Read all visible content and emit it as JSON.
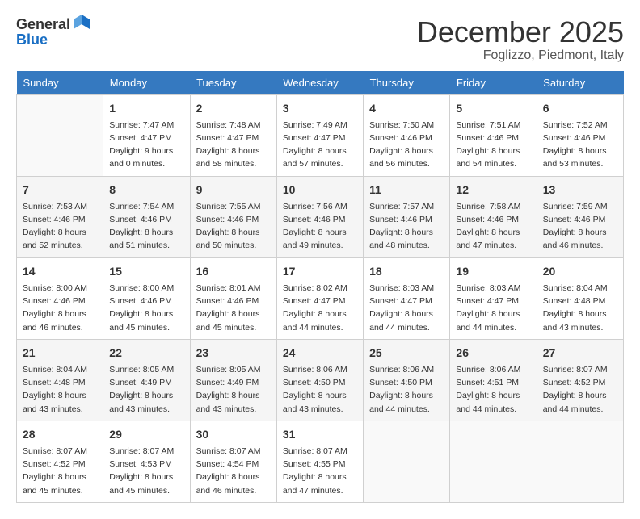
{
  "header": {
    "logo_general": "General",
    "logo_blue": "Blue",
    "month_title": "December 2025",
    "location": "Foglizzo, Piedmont, Italy"
  },
  "days_of_week": [
    "Sunday",
    "Monday",
    "Tuesday",
    "Wednesday",
    "Thursday",
    "Friday",
    "Saturday"
  ],
  "weeks": [
    [
      {
        "day": "",
        "info": ""
      },
      {
        "day": "1",
        "info": "Sunrise: 7:47 AM\nSunset: 4:47 PM\nDaylight: 9 hours\nand 0 minutes."
      },
      {
        "day": "2",
        "info": "Sunrise: 7:48 AM\nSunset: 4:47 PM\nDaylight: 8 hours\nand 58 minutes."
      },
      {
        "day": "3",
        "info": "Sunrise: 7:49 AM\nSunset: 4:47 PM\nDaylight: 8 hours\nand 57 minutes."
      },
      {
        "day": "4",
        "info": "Sunrise: 7:50 AM\nSunset: 4:46 PM\nDaylight: 8 hours\nand 56 minutes."
      },
      {
        "day": "5",
        "info": "Sunrise: 7:51 AM\nSunset: 4:46 PM\nDaylight: 8 hours\nand 54 minutes."
      },
      {
        "day": "6",
        "info": "Sunrise: 7:52 AM\nSunset: 4:46 PM\nDaylight: 8 hours\nand 53 minutes."
      }
    ],
    [
      {
        "day": "7",
        "info": "Sunrise: 7:53 AM\nSunset: 4:46 PM\nDaylight: 8 hours\nand 52 minutes."
      },
      {
        "day": "8",
        "info": "Sunrise: 7:54 AM\nSunset: 4:46 PM\nDaylight: 8 hours\nand 51 minutes."
      },
      {
        "day": "9",
        "info": "Sunrise: 7:55 AM\nSunset: 4:46 PM\nDaylight: 8 hours\nand 50 minutes."
      },
      {
        "day": "10",
        "info": "Sunrise: 7:56 AM\nSunset: 4:46 PM\nDaylight: 8 hours\nand 49 minutes."
      },
      {
        "day": "11",
        "info": "Sunrise: 7:57 AM\nSunset: 4:46 PM\nDaylight: 8 hours\nand 48 minutes."
      },
      {
        "day": "12",
        "info": "Sunrise: 7:58 AM\nSunset: 4:46 PM\nDaylight: 8 hours\nand 47 minutes."
      },
      {
        "day": "13",
        "info": "Sunrise: 7:59 AM\nSunset: 4:46 PM\nDaylight: 8 hours\nand 46 minutes."
      }
    ],
    [
      {
        "day": "14",
        "info": "Sunrise: 8:00 AM\nSunset: 4:46 PM\nDaylight: 8 hours\nand 46 minutes."
      },
      {
        "day": "15",
        "info": "Sunrise: 8:00 AM\nSunset: 4:46 PM\nDaylight: 8 hours\nand 45 minutes."
      },
      {
        "day": "16",
        "info": "Sunrise: 8:01 AM\nSunset: 4:46 PM\nDaylight: 8 hours\nand 45 minutes."
      },
      {
        "day": "17",
        "info": "Sunrise: 8:02 AM\nSunset: 4:47 PM\nDaylight: 8 hours\nand 44 minutes."
      },
      {
        "day": "18",
        "info": "Sunrise: 8:03 AM\nSunset: 4:47 PM\nDaylight: 8 hours\nand 44 minutes."
      },
      {
        "day": "19",
        "info": "Sunrise: 8:03 AM\nSunset: 4:47 PM\nDaylight: 8 hours\nand 44 minutes."
      },
      {
        "day": "20",
        "info": "Sunrise: 8:04 AM\nSunset: 4:48 PM\nDaylight: 8 hours\nand 43 minutes."
      }
    ],
    [
      {
        "day": "21",
        "info": "Sunrise: 8:04 AM\nSunset: 4:48 PM\nDaylight: 8 hours\nand 43 minutes."
      },
      {
        "day": "22",
        "info": "Sunrise: 8:05 AM\nSunset: 4:49 PM\nDaylight: 8 hours\nand 43 minutes."
      },
      {
        "day": "23",
        "info": "Sunrise: 8:05 AM\nSunset: 4:49 PM\nDaylight: 8 hours\nand 43 minutes."
      },
      {
        "day": "24",
        "info": "Sunrise: 8:06 AM\nSunset: 4:50 PM\nDaylight: 8 hours\nand 43 minutes."
      },
      {
        "day": "25",
        "info": "Sunrise: 8:06 AM\nSunset: 4:50 PM\nDaylight: 8 hours\nand 44 minutes."
      },
      {
        "day": "26",
        "info": "Sunrise: 8:06 AM\nSunset: 4:51 PM\nDaylight: 8 hours\nand 44 minutes."
      },
      {
        "day": "27",
        "info": "Sunrise: 8:07 AM\nSunset: 4:52 PM\nDaylight: 8 hours\nand 44 minutes."
      }
    ],
    [
      {
        "day": "28",
        "info": "Sunrise: 8:07 AM\nSunset: 4:52 PM\nDaylight: 8 hours\nand 45 minutes."
      },
      {
        "day": "29",
        "info": "Sunrise: 8:07 AM\nSunset: 4:53 PM\nDaylight: 8 hours\nand 45 minutes."
      },
      {
        "day": "30",
        "info": "Sunrise: 8:07 AM\nSunset: 4:54 PM\nDaylight: 8 hours\nand 46 minutes."
      },
      {
        "day": "31",
        "info": "Sunrise: 8:07 AM\nSunset: 4:55 PM\nDaylight: 8 hours\nand 47 minutes."
      },
      {
        "day": "",
        "info": ""
      },
      {
        "day": "",
        "info": ""
      },
      {
        "day": "",
        "info": ""
      }
    ]
  ]
}
